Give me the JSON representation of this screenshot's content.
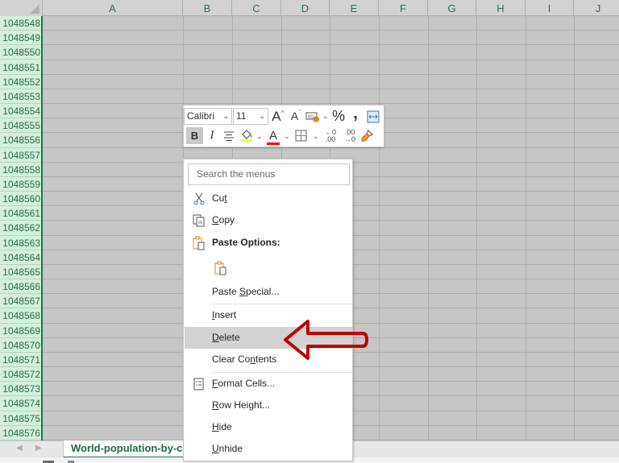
{
  "spreadsheet": {
    "columns": [
      "A",
      "B",
      "C",
      "D",
      "E",
      "F",
      "G",
      "H",
      "I",
      "J"
    ],
    "rows": [
      "1048548",
      "1048549",
      "1048550",
      "1048551",
      "1048552",
      "1048553",
      "1048554",
      "1048555",
      "1048556",
      "1048557",
      "1048558",
      "1048559",
      "1048560",
      "1048561",
      "1048562",
      "1048563",
      "1048564",
      "1048565",
      "1048566",
      "1048567",
      "1048568",
      "1048569",
      "1048570",
      "1048571",
      "1048572",
      "1048573",
      "1048574",
      "1048575",
      "1048576"
    ],
    "selected_rows_header_color": "#d3eedd",
    "accent": "#217346"
  },
  "sheet_tabs": {
    "prev_icon": "triangle-left",
    "next_icon": "triangle-right",
    "active_tab": "World-population-by-c"
  },
  "mini_toolbar": {
    "font_name": "Calibri",
    "font_size": "11",
    "increase_font": "A",
    "decrease_font": "A",
    "percent": "%",
    "comma": "❟",
    "bold": "B",
    "italic": "I",
    "font_color_letter": "A",
    "increase_decimal": ".00",
    "decrease_decimal": ".00",
    "fill_color": "#ffff00",
    "font_color": "#ff0000"
  },
  "context_menu": {
    "search_placeholder": "Search the menus",
    "items": {
      "cut": {
        "pre": "Cu",
        "accel": "t",
        "post": ""
      },
      "copy": {
        "pre": "",
        "accel": "C",
        "post": "opy"
      },
      "paste_options": "Paste Options:",
      "paste_special": {
        "pre": "Paste ",
        "accel": "S",
        "post": "pecial..."
      },
      "insert": {
        "pre": "",
        "accel": "I",
        "post": "nsert"
      },
      "delete": {
        "pre": "",
        "accel": "D",
        "post": "elete"
      },
      "clear_contents": {
        "pre": "Clear Co",
        "accel": "n",
        "post": "tents"
      },
      "format_cells": {
        "pre": "",
        "accel": "F",
        "post": "ormat Cells..."
      },
      "row_height": {
        "pre": "",
        "accel": "R",
        "post": "ow Height..."
      },
      "hide": {
        "pre": "",
        "accel": "H",
        "post": "ide"
      },
      "unhide": {
        "pre": "",
        "accel": "U",
        "post": "nhide"
      }
    },
    "highlighted": "Delete"
  },
  "annotation": {
    "type": "arrow",
    "points_to": "Delete",
    "color": "#c00000"
  }
}
